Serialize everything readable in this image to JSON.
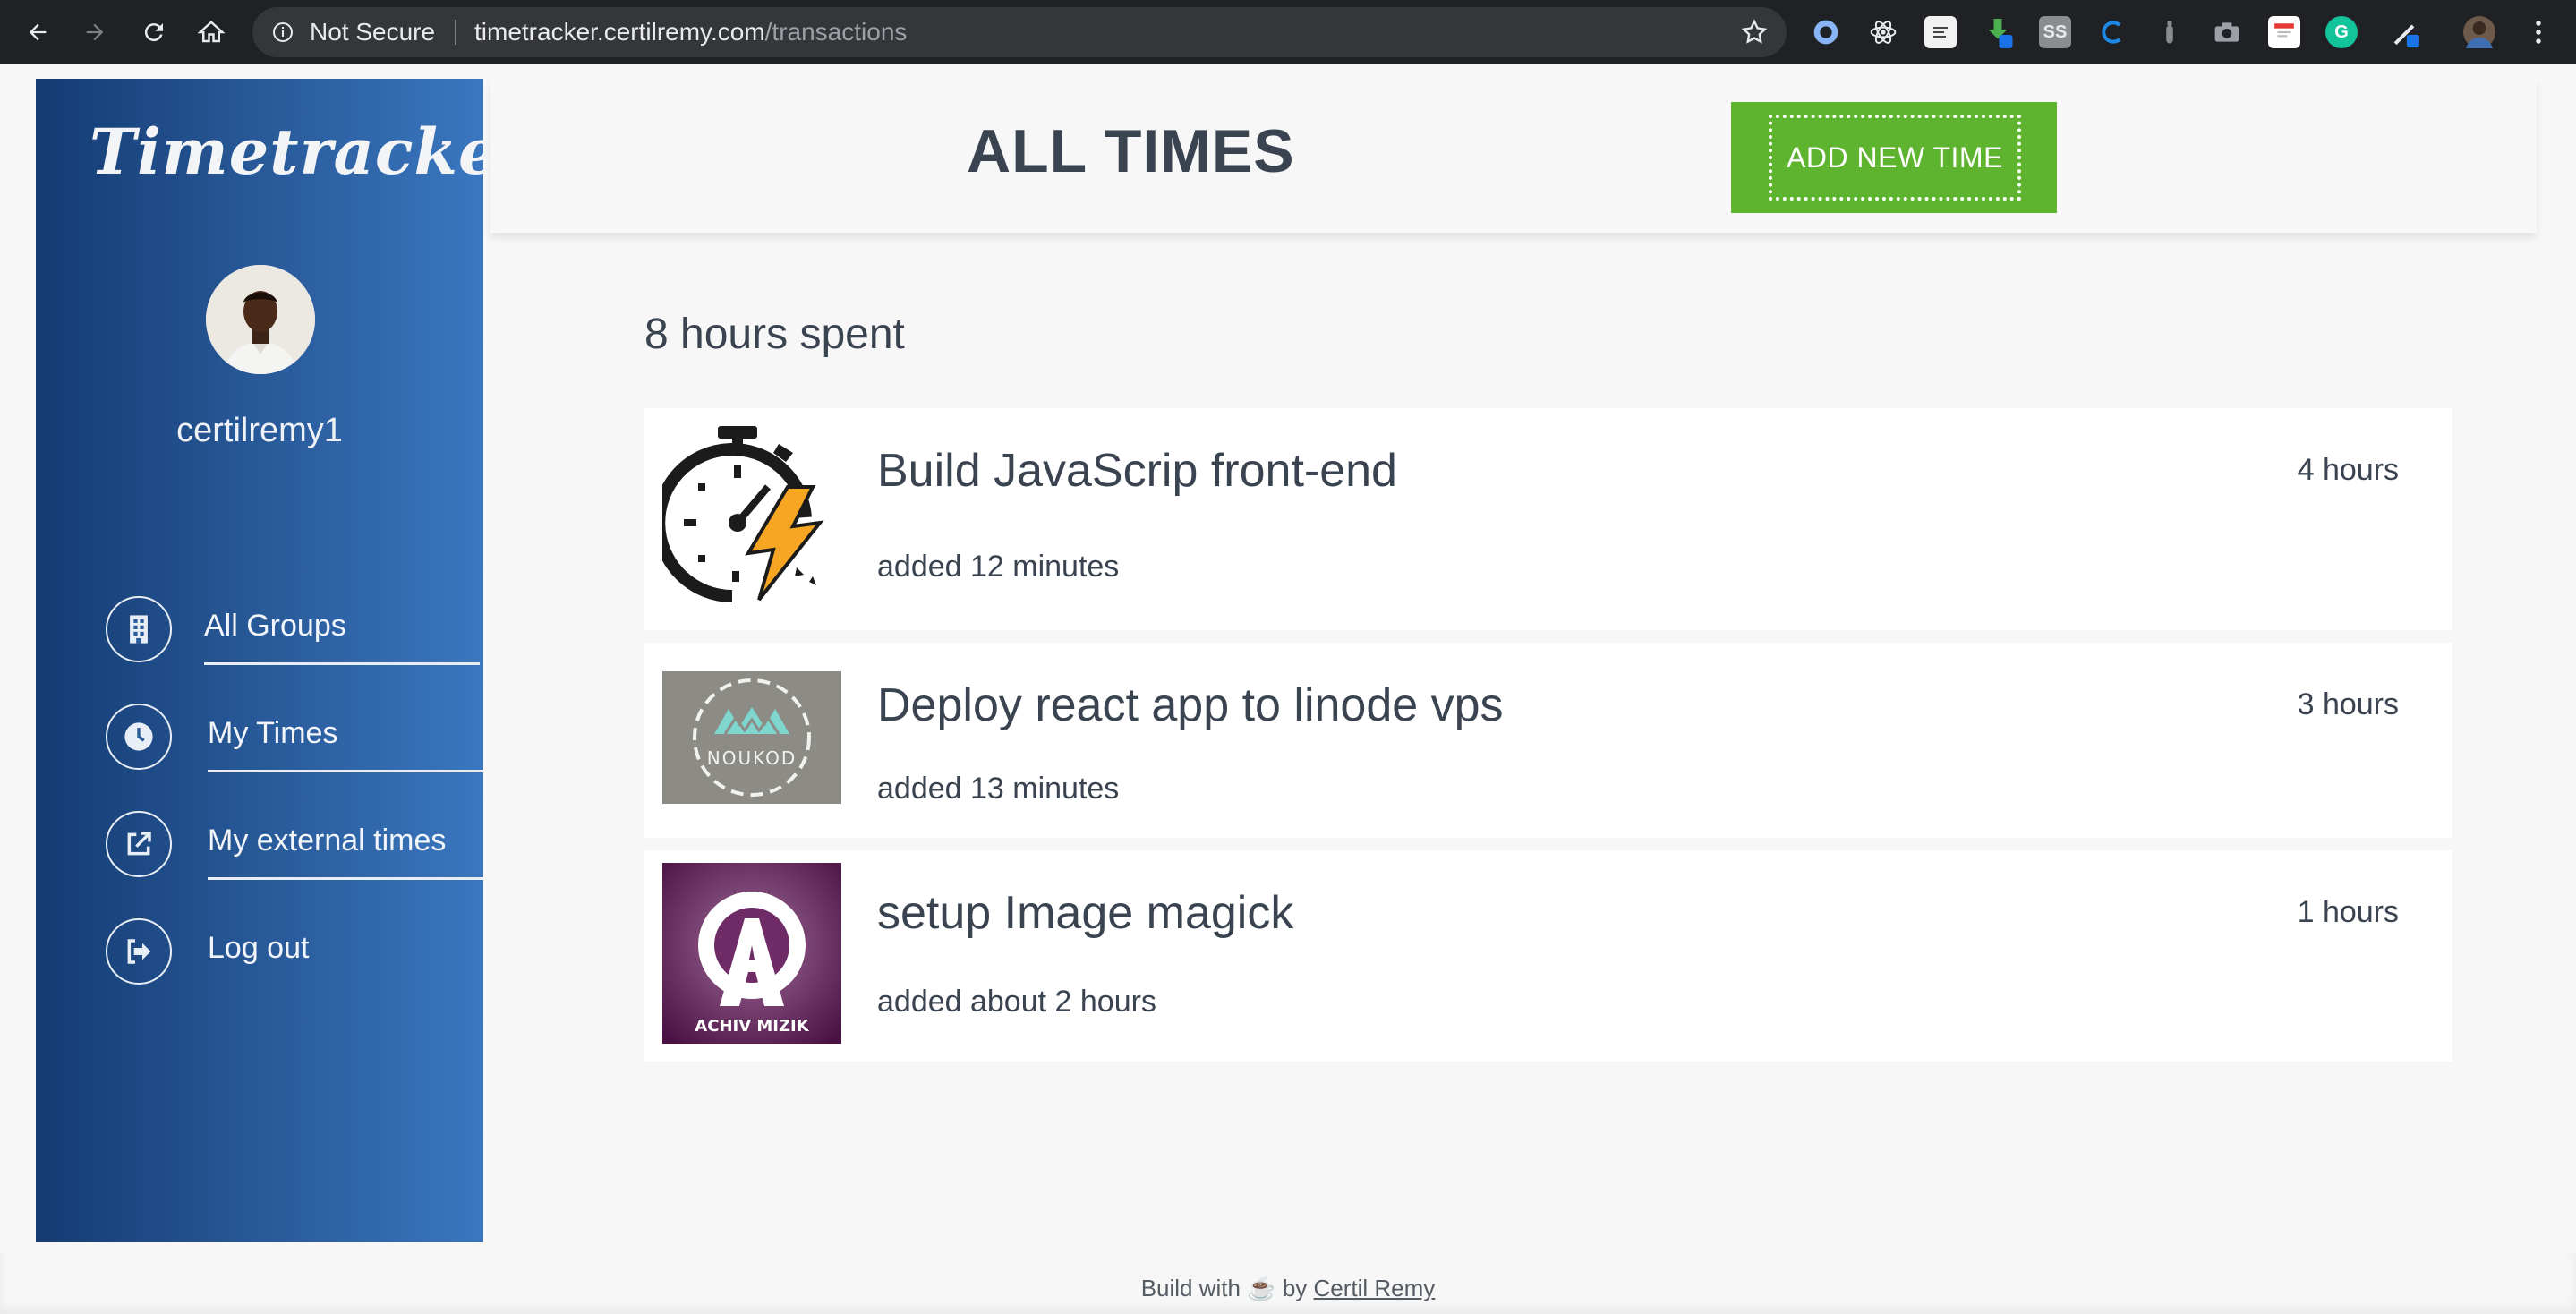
{
  "browser": {
    "security_label": "Not Secure",
    "url_host": "timetracker.certilremy.com",
    "url_path": "/transactions"
  },
  "sidebar": {
    "brand": "Timetracker",
    "username": "certilremy1",
    "items": [
      {
        "label": "All Groups",
        "icon": "building-icon"
      },
      {
        "label": "My Times",
        "icon": "clock-icon"
      },
      {
        "label": "My external times",
        "icon": "external-link-icon"
      },
      {
        "label": "Log out",
        "icon": "sign-out-icon"
      }
    ]
  },
  "header": {
    "title": "ALL TIMES",
    "add_button": "ADD NEW TIME"
  },
  "summary": "8 hours spent",
  "entries": [
    {
      "title": "Build JavaScrip front-end",
      "added": "added 12 minutes",
      "hours": "4 hours",
      "thumb": "stopwatch-lightning-icon"
    },
    {
      "title": "Deploy react app to linode vps",
      "added": "added 13 minutes",
      "hours": "3 hours",
      "thumb": "noukod-logo",
      "thumb_text": "NOUKOD"
    },
    {
      "title": "setup Image magick",
      "added": "added about 2 hours",
      "hours": "1 hours",
      "thumb": "achiv-mizik-logo",
      "thumb_text": "ACHIV MIZIK"
    }
  ],
  "footer": {
    "prefix": "Build with",
    "coffee": "☕",
    "by": "by",
    "author": "Certil Remy"
  },
  "colors": {
    "sidebar_start": "#143b72",
    "sidebar_end": "#3a77c0",
    "add_button": "#5fb42f",
    "chrome": "#202124"
  }
}
